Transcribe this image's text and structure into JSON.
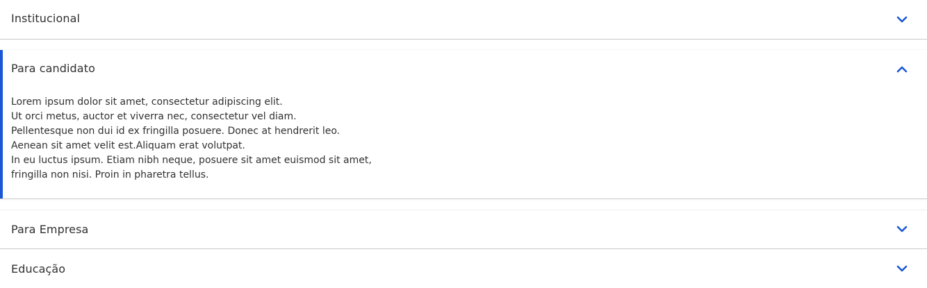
{
  "accordion": {
    "accent_color": "#1a56d6",
    "items": [
      {
        "title": "Institucional",
        "expanded": false,
        "icon": "chevron-down-icon"
      },
      {
        "title": "Para candidato",
        "expanded": true,
        "icon": "chevron-up-icon",
        "body_lines": [
          "Lorem ipsum dolor sit amet, consectetur adipiscing elit.",
          "Ut orci metus, auctor et viverra nec, consectetur vel diam.",
          "Pellentesque non dui id ex fringilla posuere. Donec at hendrerit leo.",
          "Aenean sit amet velit est.Aliquam erat volutpat.",
          "In eu luctus ipsum. Etiam nibh neque, posuere sit amet euismod sit amet,",
          "fringilla non nisi. Proin in pharetra tellus."
        ]
      },
      {
        "title": "Para Empresa",
        "expanded": false,
        "icon": "chevron-down-icon"
      },
      {
        "title": "Educação",
        "expanded": false,
        "icon": "chevron-down-icon"
      }
    ]
  }
}
